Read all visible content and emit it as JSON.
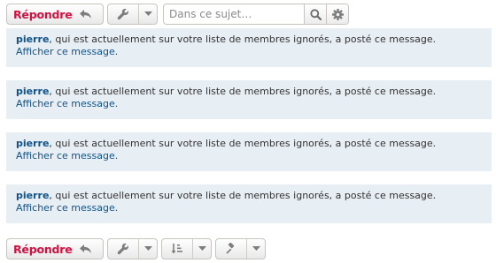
{
  "toolbar_top": {
    "reply_label": "Répondre",
    "search_placeholder": "Dans ce sujet…"
  },
  "toolbar_bottom": {
    "reply_label": "Répondre"
  },
  "posts": [
    {
      "author": "pierre",
      "message": ", qui est actuellement sur votre liste de membres ignorés, a posté ce message.",
      "link": "Afficher ce message."
    },
    {
      "author": "pierre",
      "message": ", qui est actuellement sur votre liste de membres ignorés, a posté ce message.",
      "link": "Afficher ce message."
    },
    {
      "author": "pierre",
      "message": ", qui est actuellement sur votre liste de membres ignorés, a posté ce message.",
      "link": "Afficher ce message."
    },
    {
      "author": "pierre",
      "message": ", qui est actuellement sur votre liste de membres ignorés, a posté ce message.",
      "link": "Afficher ce message."
    }
  ],
  "icons": {
    "reply": "reply-arrow-icon",
    "tools": "wrench-icon",
    "dropdown": "caret-down-icon",
    "search": "magnifier-icon",
    "settings": "gear-icon",
    "sort": "sort-icon",
    "moderation": "gavel-icon"
  },
  "colors": {
    "reply_label": "#d31141",
    "post_background": "#e7eef4",
    "link": "#105289"
  }
}
